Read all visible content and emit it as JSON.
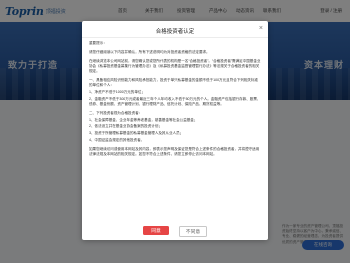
{
  "header": {
    "logo_text": "Toprin",
    "logo_cn": "顶福投资",
    "nav": [
      "首页",
      "关于我们",
      "投资管理",
      "产品中心",
      "动态资讯",
      "联系我们"
    ],
    "auth": "登录 / 注册"
  },
  "banner": {
    "slogan_left": "致力于打造",
    "slogan_right": "资本理财"
  },
  "background": {
    "right_text": "作为一家专业的资产管理公司，顶福投资始终坚持以客户为中心，秉承诚信、专业、稳健的经营理念，为投资者提供优质的资产管理服务。",
    "float_button": "在线咨询"
  },
  "modal": {
    "title": "合格投资者认定",
    "close": "×",
    "paragraphs": [
      "重要提示：",
      "请您仔细阅读以下内容并确认，所有下述说明均为对投资者资格的法定要求。",
      "在继续浏览本公司网站前，请您确认您或您所代表的机构是一名“合格投资者”。“合格投资者”需满足中国基金业协会《私募投资基金募集行为管理办法》及《私募投资基金监督管理暂行办法》等法规关于合格投资者的相关规定。",
      "一、具备相应风险识别能力和风险承担能力，投资于单只私募基金的金额不低于100万元且符合下列相关标准的单位和个人：",
      "1、净资产不低于1000万元的单位；",
      "2、金融资产不低于300万元或者最近三年个人年均收入不低于50万元的个人。金融资产包括银行存款、股票、债券、基金份额、资产管理计划、银行理财产品、信托计划、保险产品、期货权益等。",
      "二、下列投资者视为合格投资者：",
      "1、社会保障基金、企业年金等养老基金，慈善基金等社会公益基金；",
      "2、依法设立并在基金业协会备案的投资计划；",
      "3、投资于所管理私募基金的私募基金管理人及其从业人员；",
      "4、中国证监会规定的其他投资者。",
      "如果您继续访问或使用本网站及其内容，即表示您声明及保证您是符合上述条件的合格投资者，并将遵守适用法律法规及本网站的相关规定。如您不符合上述条件，请您立即停止访问本网站。"
    ],
    "agree_button": "同意",
    "disagree_button": "不同意"
  },
  "colors": {
    "brand_blue": "#1a5fa8",
    "agree_red": "#e64545",
    "banner_blue": "#2a5aa0",
    "float_blue": "#2f6fd6"
  }
}
